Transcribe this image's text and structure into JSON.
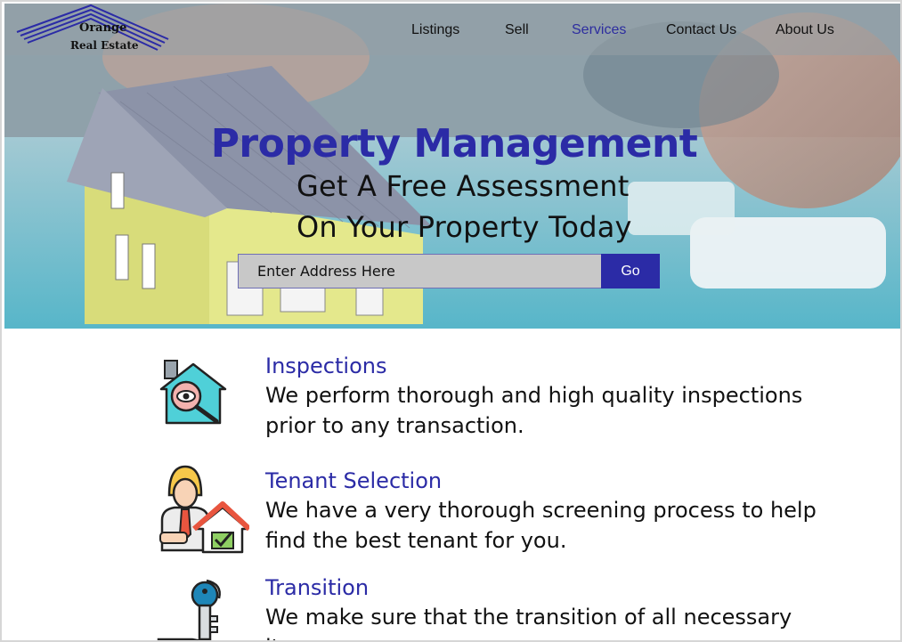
{
  "brand": {
    "line1": "Orange",
    "line2": "Real Estate"
  },
  "nav": {
    "items": [
      {
        "label": "Listings"
      },
      {
        "label": "Sell"
      },
      {
        "label": "Services"
      },
      {
        "label": "Contact Us"
      },
      {
        "label": "About Us"
      }
    ],
    "active": "Services"
  },
  "hero": {
    "title": "Property Management",
    "subtitle_line1": "Get A Free Assessment",
    "subtitle_line2": "On Your Property Today",
    "search": {
      "placeholder": "Enter Address Here",
      "value": ""
    },
    "go_label": "Go"
  },
  "services": [
    {
      "title": "Inspections",
      "description": "We perform thorough and high quality inspections prior to any transaction.",
      "icon": "house-inspection-icon"
    },
    {
      "title": "Tenant Selection",
      "description": "We have a very thorough screening process to help find the best tenant for you.",
      "icon": "tenant-agent-icon"
    },
    {
      "title": "Transition",
      "description": "We make sure that the transition of all necessary items",
      "icon": "key-hand-icon"
    }
  ],
  "colors": {
    "accent": "#2b2ba6",
    "input_bg": "#c8c8c8",
    "nav_bg": "#96a0a5"
  }
}
